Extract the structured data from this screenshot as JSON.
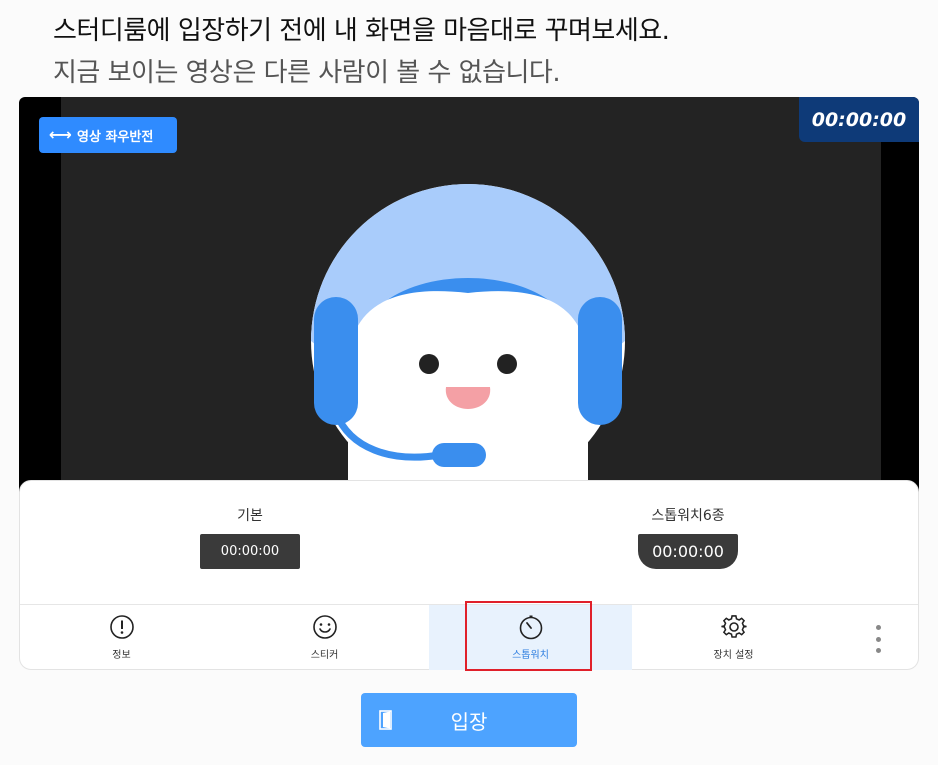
{
  "header": {
    "title": "스터디룸에 입장하기 전에 내 화면을 마음대로 꾸며보세요.",
    "subtitle": "지금 보이는 영상은 다른 사람이 볼 수 없습니다."
  },
  "video": {
    "mirror_label": "영상 좌우반전",
    "timer": "00:00:00"
  },
  "timer_options": [
    {
      "label": "기본",
      "value": "00:00:00"
    },
    {
      "label": "스톱워치6종",
      "value": "00:00:00"
    }
  ],
  "tabs": {
    "info": "정보",
    "sticker": "스티커",
    "stopwatch": "스톱워치",
    "device": "장치 설정"
  },
  "enter_button": "입장",
  "colors": {
    "accent": "#2f8bff",
    "timer_bg": "#0e3a78",
    "highlight": "#e0202a",
    "enter_bg": "#4da3ff"
  }
}
